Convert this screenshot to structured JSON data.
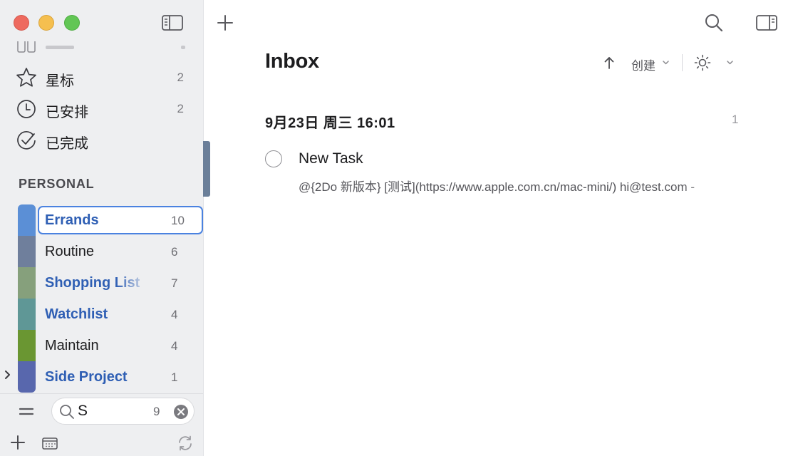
{
  "colors": {
    "sidebar_bg": "#eeeff1",
    "selection_border": "#4a82e0",
    "list_link_blue": "#2f5fb4",
    "traffic_close": "#ee6a5f",
    "traffic_minimize": "#f5bf4f",
    "traffic_maximize": "#62c655"
  },
  "sidebar": {
    "smart_lists": [
      {
        "label": "星标",
        "count": "2",
        "icon": "star-icon"
      },
      {
        "label": "已安排",
        "count": "2",
        "icon": "clock-icon"
      },
      {
        "label": "已完成",
        "count": "",
        "icon": "checkmark-circle-icon"
      }
    ],
    "section_title": "PERSONAL",
    "lists": [
      {
        "label": "Errands",
        "count": "10",
        "color": "#5b8fd6",
        "selected": true
      },
      {
        "label": "Routine",
        "count": "6",
        "color": "#6f7f9c"
      },
      {
        "label": "Shopping List",
        "count": "7",
        "color": "#86a07c"
      },
      {
        "label": "Watchlist",
        "count": "4",
        "color": "#5f9796"
      },
      {
        "label": "Maintain",
        "count": "4",
        "color": "#6a9632"
      },
      {
        "label": "Side Project",
        "count": "1",
        "color": "#5867ad"
      }
    ],
    "search": {
      "value": "S",
      "result_count": "9"
    }
  },
  "main": {
    "title": "Inbox",
    "sort_label": "创建",
    "group": {
      "date_label": "9月23日 周三 16:01",
      "count": "1"
    },
    "tasks": [
      {
        "title": "New Task",
        "note": "@{2Do 新版本} [测试](https://www.apple.com.cn/mac-mini/) hi@test.com -"
      }
    ]
  }
}
